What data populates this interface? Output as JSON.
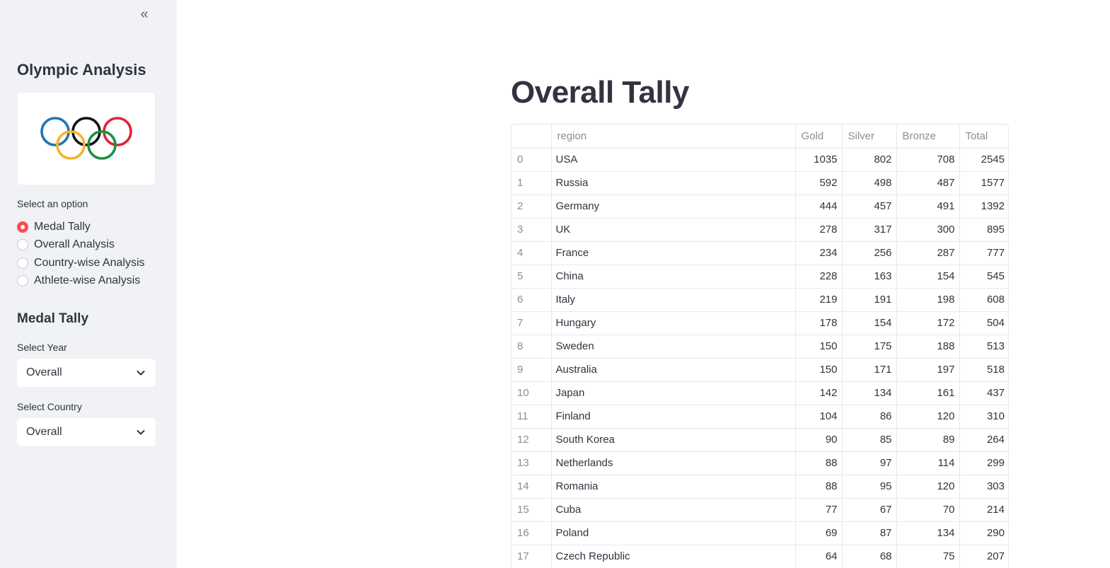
{
  "sidebar": {
    "title": "Olympic Analysis",
    "option_label": "Select an option",
    "options": [
      {
        "label": "Medal Tally",
        "checked": true
      },
      {
        "label": "Overall Analysis",
        "checked": false
      },
      {
        "label": "Country-wise Analysis",
        "checked": false
      },
      {
        "label": "Athlete-wise Analysis",
        "checked": false
      }
    ],
    "section_title": "Medal Tally",
    "year_label": "Select Year",
    "year_value": "Overall",
    "country_label": "Select Country",
    "country_value": "Overall"
  },
  "main": {
    "title": "Overall Tally",
    "table": {
      "columns": [
        "",
        "region",
        "Gold",
        "Silver",
        "Bronze",
        "Total"
      ],
      "rows": [
        [
          "0",
          "USA",
          "1035",
          "802",
          "708",
          "2545"
        ],
        [
          "1",
          "Russia",
          "592",
          "498",
          "487",
          "1577"
        ],
        [
          "2",
          "Germany",
          "444",
          "457",
          "491",
          "1392"
        ],
        [
          "3",
          "UK",
          "278",
          "317",
          "300",
          "895"
        ],
        [
          "4",
          "France",
          "234",
          "256",
          "287",
          "777"
        ],
        [
          "5",
          "China",
          "228",
          "163",
          "154",
          "545"
        ],
        [
          "6",
          "Italy",
          "219",
          "191",
          "198",
          "608"
        ],
        [
          "7",
          "Hungary",
          "178",
          "154",
          "172",
          "504"
        ],
        [
          "8",
          "Sweden",
          "150",
          "175",
          "188",
          "513"
        ],
        [
          "9",
          "Australia",
          "150",
          "171",
          "197",
          "518"
        ],
        [
          "10",
          "Japan",
          "142",
          "134",
          "161",
          "437"
        ],
        [
          "11",
          "Finland",
          "104",
          "86",
          "120",
          "310"
        ],
        [
          "12",
          "South Korea",
          "90",
          "85",
          "89",
          "264"
        ],
        [
          "13",
          "Netherlands",
          "88",
          "97",
          "114",
          "299"
        ],
        [
          "14",
          "Romania",
          "88",
          "95",
          "120",
          "303"
        ],
        [
          "15",
          "Cuba",
          "77",
          "67",
          "70",
          "214"
        ],
        [
          "16",
          "Poland",
          "69",
          "87",
          "134",
          "290"
        ],
        [
          "17",
          "Czech Republic",
          "64",
          "68",
          "75",
          "207"
        ]
      ]
    }
  },
  "colors": {
    "accent": "#ff4b4b",
    "sidebar_bg": "#f0f2f6",
    "ring_blue": "#1f77b4",
    "ring_yellow": "#f7b32b",
    "ring_black": "#111111",
    "ring_green": "#1a9140",
    "ring_red": "#e0243a"
  },
  "icons": {
    "collapse": "double-chevron-left-icon",
    "dropdown": "chevron-down-icon",
    "logo": "olympic-rings-logo"
  }
}
